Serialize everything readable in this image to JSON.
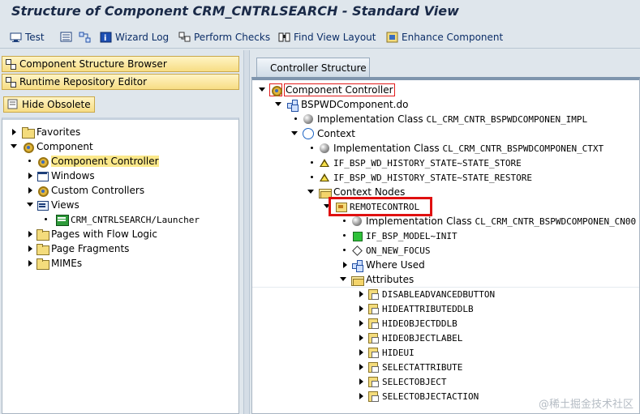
{
  "title": "Structure of Component CRM_CNTRLSEARCH - Standard View",
  "toolbar": {
    "test": "Test",
    "wizard_log": "Wizard Log",
    "perform_checks": "Perform Checks",
    "find_view_layout": "Find View Layout",
    "enhance_component": "Enhance Component"
  },
  "left": {
    "component_structure_browser": "Component Structure Browser",
    "runtime_repository_editor": "Runtime Repository Editor",
    "hide_obsolete": "Hide Obsolete",
    "tree": {
      "favorites": "Favorites",
      "component": "Component",
      "component_controller": "Component Controller",
      "windows": "Windows",
      "custom_controllers": "Custom Controllers",
      "views": "Views",
      "launcher": "CRM_CNTRLSEARCH/Launcher",
      "pages_with_flow_logic": "Pages with Flow Logic",
      "page_fragments": "Page Fragments",
      "mimes": "MIMEs"
    }
  },
  "right": {
    "tab": "Controller Structure",
    "tree": {
      "component_controller": "Component Controller",
      "bsp_component": "BSPWDComponent.do",
      "impl_class_label": "Implementation Class",
      "impl_class_value": "CL_CRM_CNTR_BSPWDCOMPONEN_IMPL",
      "context": "Context",
      "ctxt_class_label": "Implementation Class",
      "ctxt_class_value": "CL_CRM_CNTR_BSPWDCOMPONEN_CTXT",
      "history_store": "IF_BSP_WD_HISTORY_STATE~STATE_STORE",
      "history_restore": "IF_BSP_WD_HISTORY_STATE~STATE_RESTORE",
      "context_nodes": "Context Nodes",
      "remotecontrol": "REMOTECONTROL",
      "node_class_label": "Implementation Class",
      "node_class_value": "CL_CRM_CNTR_BSPWDCOMPONEN_CN00",
      "model_init": "IF_BSP_MODEL~INIT",
      "on_new_focus": "ON_NEW_FOCUS",
      "where_used": "Where Used",
      "attributes": "Attributes",
      "attribute_items": [
        "DISABLEADVANCEDBUTTON",
        "HIDEATTRIBUTEDDLB",
        "HIDEOBJECTDDLB",
        "HIDEOBJECTLABEL",
        "HIDEUI",
        "SELECTATTRIBUTE",
        "SELECTOBJECT",
        "SELECTOBJECTACTION"
      ]
    }
  },
  "watermark": "@稀土掘金技术社区",
  "colors": {
    "highlight_red": "#e01010",
    "selection_yellow": "#fbe88a",
    "background": "#dfe6ec"
  }
}
